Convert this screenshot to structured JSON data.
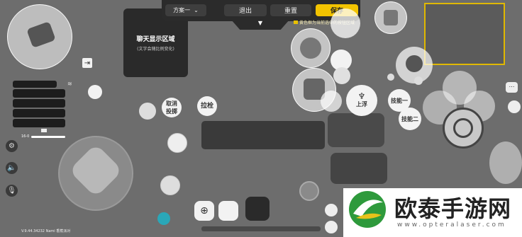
{
  "toolbar": {
    "scheme_label": "方案一",
    "exit_label": "退出",
    "reset_label": "重置",
    "save_label": "保存"
  },
  "chat_area": {
    "title": "聊天显示区域",
    "subtitle": "(文字会随比例变化)"
  },
  "hint": {
    "text": "黄色框为当前选中的按钮区域"
  },
  "buttons": {
    "cancel_cast": "取消\n投掷",
    "pull_bolt": "拉栓",
    "float_up": "上浮",
    "skill_one": "技能一",
    "skill_two": "技能二"
  },
  "status": {
    "left_tag": "16-0",
    "version": "V.9.44.34232 Nami 香蕉派对"
  },
  "watermark": {
    "brand": "欧泰手游网",
    "url": "www.opteralaser.com"
  },
  "colors": {
    "save_bg": "#f2c300",
    "background": "#6d6d6d",
    "hint_yellow": "#e8c000"
  }
}
